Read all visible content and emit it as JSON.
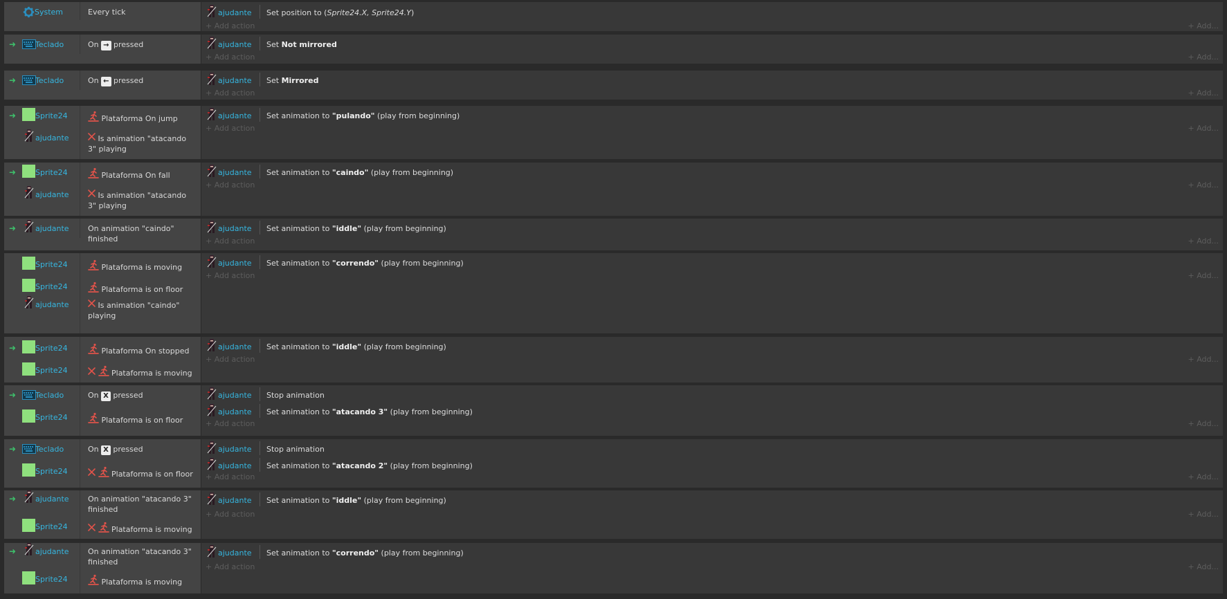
{
  "add_action_label": "Add action",
  "add_right_label": "Add...",
  "system_obj": "System",
  "teclado_obj": "Teclado",
  "sprite_obj": "Sprite24",
  "ajudante_obj": "ajudante",
  "events": [
    {
      "conditions": [
        {
          "object": "System",
          "text": "Every tick"
        }
      ],
      "actions": [
        {
          "object": "ajudante",
          "pre": "Set position to (",
          "em": "Sprite24.X, Sprite24.Y",
          "post": ")"
        }
      ]
    },
    {
      "conditions": [
        {
          "object": "Teclado",
          "pre": "On",
          "key": "→",
          "post": "pressed"
        }
      ],
      "actions": [
        {
          "object": "ajudante",
          "pre": "Set ",
          "bold": "Not mirrored",
          "post": ""
        }
      ]
    },
    {
      "conditions": [
        {
          "object": "Teclado",
          "pre": "On",
          "key": "←",
          "post": "pressed"
        }
      ],
      "actions": [
        {
          "object": "ajudante",
          "pre": "Set ",
          "bold": "Mirrored",
          "post": ""
        }
      ]
    },
    {
      "conditions": [
        {
          "object": "Sprite24",
          "text": "Plataforma On jump"
        },
        {
          "object": "ajudante",
          "text": "Is animation \"atacando 3\" playing"
        }
      ],
      "actions": [
        {
          "object": "ajudante",
          "pre": "Set animation to ",
          "bold": "\"pulando\"",
          "post": " (play from beginning)"
        }
      ]
    },
    {
      "conditions": [
        {
          "object": "Sprite24",
          "text": "Plataforma On fall"
        },
        {
          "object": "ajudante",
          "text": "Is animation \"atacando 3\" playing"
        }
      ],
      "actions": [
        {
          "object": "ajudante",
          "pre": "Set animation to ",
          "bold": "\"caindo\"",
          "post": " (play from beginning)"
        }
      ]
    },
    {
      "conditions": [
        {
          "object": "ajudante",
          "text": "On animation \"caindo\" finished"
        }
      ],
      "actions": [
        {
          "object": "ajudante",
          "pre": "Set animation to ",
          "bold": "\"iddle\"",
          "post": " (play from beginning)"
        }
      ]
    },
    {
      "conditions": [
        {
          "object": "Sprite24",
          "text": "Plataforma is moving"
        },
        {
          "object": "Sprite24",
          "text": "Plataforma is on floor"
        },
        {
          "object": "ajudante",
          "text": "Is animation \"caindo\" playing"
        }
      ],
      "actions": [
        {
          "object": "ajudante",
          "pre": "Set animation to ",
          "bold": "\"correndo\"",
          "post": " (play from beginning)"
        }
      ]
    },
    {
      "conditions": [
        {
          "object": "Sprite24",
          "text": "Plataforma On stopped"
        },
        {
          "object": "Sprite24",
          "text": "Plataforma is moving"
        }
      ],
      "actions": [
        {
          "object": "ajudante",
          "pre": "Set animation to ",
          "bold": "\"iddle\"",
          "post": " (play from beginning)"
        }
      ]
    },
    {
      "conditions": [
        {
          "object": "Teclado",
          "pre": "On",
          "key": "X",
          "post": "pressed"
        },
        {
          "object": "Sprite24",
          "text": "Plataforma is on floor"
        }
      ],
      "actions": [
        {
          "object": "ajudante",
          "pre": "Stop animation",
          "bold": "",
          "post": ""
        },
        {
          "object": "ajudante",
          "pre": "Set animation to ",
          "bold": "\"atacando 3\"",
          "post": " (play from beginning)"
        }
      ]
    },
    {
      "conditions": [
        {
          "object": "Teclado",
          "pre": "On",
          "key": "X",
          "post": "pressed"
        },
        {
          "object": "Sprite24",
          "text": "Plataforma is on floor"
        }
      ],
      "actions": [
        {
          "object": "ajudante",
          "pre": "Stop animation",
          "bold": "",
          "post": ""
        },
        {
          "object": "ajudante",
          "pre": "Set animation to ",
          "bold": "\"atacando 2\"",
          "post": " (play from beginning)"
        }
      ]
    },
    {
      "conditions": [
        {
          "object": "ajudante",
          "text": "On animation \"atacando 3\" finished"
        },
        {
          "object": "Sprite24",
          "text": "Plataforma is moving"
        }
      ],
      "actions": [
        {
          "object": "ajudante",
          "pre": "Set animation to ",
          "bold": "\"iddle\"",
          "post": " (play from beginning)"
        }
      ]
    },
    {
      "conditions": [
        {
          "object": "ajudante",
          "text": "On animation \"atacando 3\" finished"
        },
        {
          "object": "Sprite24",
          "text": "Plataforma is moving"
        }
      ],
      "actions": [
        {
          "object": "ajudante",
          "pre": "Set animation to ",
          "bold": "\"correndo\"",
          "post": " (play from beginning)"
        }
      ]
    }
  ]
}
